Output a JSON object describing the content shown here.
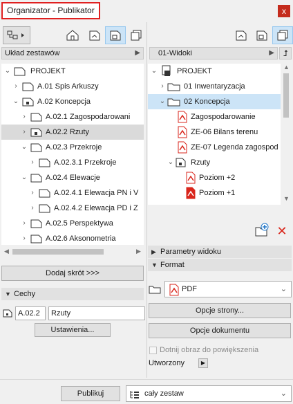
{
  "window": {
    "title": "Organizator - Publikator",
    "close": "x"
  },
  "left": {
    "combo": "Układ zestawów",
    "tree": [
      {
        "label": "PROJEKT"
      },
      {
        "label": "A.01 Spis Arkuszy"
      },
      {
        "label": "A.02 Koncepcja"
      },
      {
        "label": "A.02.1 Zagospodarowani"
      },
      {
        "label": "A.02.2 Rzuty"
      },
      {
        "label": "A.02.3 Przekroje"
      },
      {
        "label": "A.02.3.1 Przekroje"
      },
      {
        "label": "A.02.4 Elewacje"
      },
      {
        "label": "A.02.4.1 Elewacja PN i V"
      },
      {
        "label": "A.02.4.2 Elewacja PD i Z"
      },
      {
        "label": "A.02.5 Perspektywa"
      },
      {
        "label": "A.02.6 Aksonometria"
      }
    ],
    "add_shortcut": "Dodaj skrót >>>",
    "cechy": {
      "header": "Cechy",
      "id_value": "A.02.2",
      "name_value": "Rzuty",
      "settings": "Ustawienia..."
    }
  },
  "right": {
    "combo": "01-Widoki",
    "tree": [
      {
        "label": "PROJEKT"
      },
      {
        "label": "01 Inwentaryzacja"
      },
      {
        "label": "02 Koncepcja"
      },
      {
        "label": "Zagospodarowanie"
      },
      {
        "label": "ZE-06 Bilans terenu"
      },
      {
        "label": "ZE-07 Legenda zagospod"
      },
      {
        "label": "Rzuty"
      },
      {
        "label": "Poziom +2"
      },
      {
        "label": "Poziom +1"
      }
    ],
    "params_header": "Parametry widoku",
    "format_header": "Format",
    "format_value": "PDF",
    "page_options": "Opcje strony...",
    "doc_options": "Opcje dokumentu",
    "crop_label": "Dotnij obraz do powiększenia",
    "created_label": "Utworzony"
  },
  "bottom": {
    "publish": "Publikuj",
    "scope": "cały zestaw"
  },
  "colors": {
    "red_icon": "#d9261c",
    "selection_blue": "#cce4f7",
    "title_border": "#e02020"
  }
}
